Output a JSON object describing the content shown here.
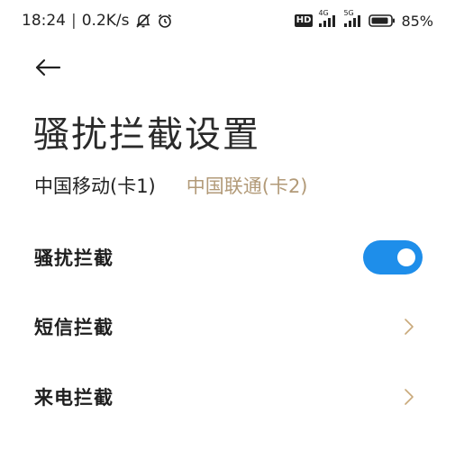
{
  "status_bar": {
    "time": "18:24",
    "separator": "|",
    "speed": "0.2K/s",
    "hd_label": "HD",
    "net1": "4G",
    "net2": "5G",
    "battery": "85%"
  },
  "header": {
    "title": "骚扰拦截设置"
  },
  "sim_tabs": [
    {
      "label": "中国移动(卡1)",
      "active": true
    },
    {
      "label": "中国联通(卡2)",
      "active": false
    }
  ],
  "settings": [
    {
      "label": "骚扰拦截",
      "control": "toggle",
      "state": "on"
    },
    {
      "label": "短信拦截",
      "control": "chevron"
    },
    {
      "label": "来电拦截",
      "control": "chevron"
    }
  ],
  "colors": {
    "accent": "#1e8eea",
    "inactive_tab": "#b29a78",
    "chevron": "#c9a97a"
  }
}
